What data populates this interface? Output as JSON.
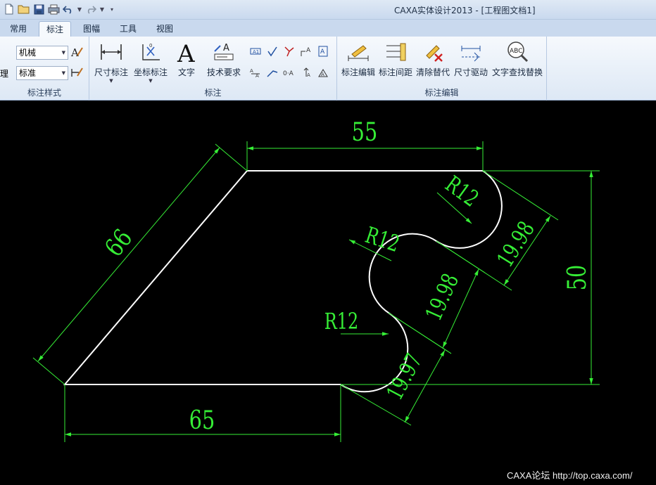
{
  "window": {
    "title": "CAXA实体设计2013 - [工程图文档1]"
  },
  "quick_access": [
    "new-icon",
    "open-icon",
    "save-icon",
    "print-icon",
    "undo-icon",
    "redo-icon",
    "customize-icon"
  ],
  "tabs": [
    "常用",
    "标注",
    "图幅",
    "工具",
    "视图"
  ],
  "active_tab": "标注",
  "ribbon": {
    "style_group": {
      "label": "标注样式",
      "truncated_label": "理",
      "combo1": "机械",
      "combo2": "标准"
    },
    "annot_group": {
      "label": "标注",
      "buttons": [
        "尺寸标注",
        "坐标标注",
        "文字",
        "技术要求"
      ]
    },
    "edit_group": {
      "label": "标注编辑",
      "buttons": [
        "标注编辑",
        "标注间距",
        "清除替代",
        "尺寸驱动",
        "文字查找替换"
      ]
    }
  },
  "drawing": {
    "dimensions": {
      "top": "55",
      "left_slant": "66",
      "bottom": "65",
      "right": "50",
      "radius_top": "R12",
      "radius_mid": "R12",
      "radius_low": "R12",
      "chord_upper": "19.98",
      "chord_mid": "19.98",
      "chord_low": "19.97"
    },
    "colors": {
      "outline": "#ffffff",
      "dimension": "#36ee36",
      "background": "#000000"
    }
  },
  "watermark": "CAXA论坛 http://top.caxa.com/"
}
